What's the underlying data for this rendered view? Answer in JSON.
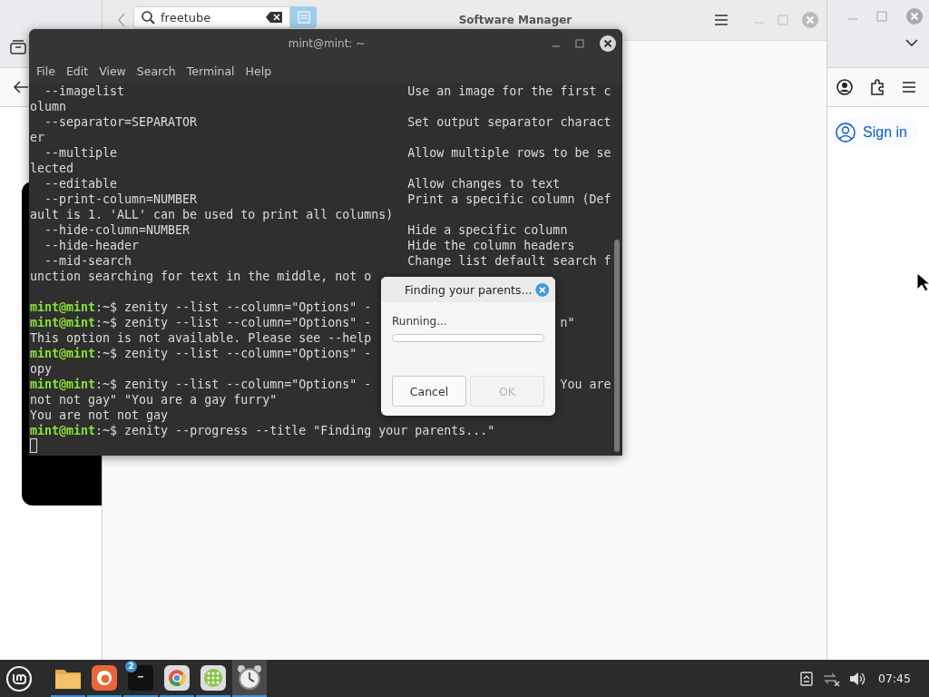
{
  "browser": {
    "sign_in": "Sign in"
  },
  "software_manager": {
    "title": "Software Manager",
    "search": {
      "value": "freetube"
    }
  },
  "terminal": {
    "title": "mint@mint: ~",
    "menu": [
      "File",
      "Edit",
      "View",
      "Search",
      "Terminal",
      "Help"
    ],
    "lines": [
      {
        "kind": "option",
        "option": "--imagelist",
        "description": "Use an image for the first c"
      },
      {
        "kind": "text",
        "text": "olumn"
      },
      {
        "kind": "option",
        "option": "--separator=SEPARATOR",
        "description": "Set output separator charact"
      },
      {
        "kind": "text",
        "text": "er"
      },
      {
        "kind": "option",
        "option": "--multiple",
        "description": "Allow multiple rows to be se"
      },
      {
        "kind": "text",
        "text": "lected"
      },
      {
        "kind": "option",
        "option": "--editable",
        "description": "Allow changes to text"
      },
      {
        "kind": "option",
        "option": "--print-column=NUMBER",
        "description": "Print a specific column (Def"
      },
      {
        "kind": "text",
        "text": "ault is 1. 'ALL' can be used to print all columns)"
      },
      {
        "kind": "option",
        "option": "--hide-column=NUMBER",
        "description": "Hide a specific column"
      },
      {
        "kind": "option",
        "option": "--hide-header",
        "description": "Hide the column headers"
      },
      {
        "kind": "option",
        "option": "--mid-search",
        "description": "Change list default search f"
      },
      {
        "kind": "text",
        "text": "unction searching for text in the middle, not o"
      },
      {
        "kind": "blank"
      },
      {
        "kind": "prompt",
        "user": "mint@mint",
        "dir": ":~$",
        "command": "zenity --list --column=\"Options\" -"
      },
      {
        "kind": "prompt",
        "user": "mint@mint",
        "dir": ":~$",
        "command": "zenity --list --column=\"Options\" -",
        "tail": "n\""
      },
      {
        "kind": "text",
        "text": "This option is not available. Please see --help"
      },
      {
        "kind": "prompt",
        "user": "mint@mint",
        "dir": ":~$",
        "command": "zenity --list --column=\"Options\" -"
      },
      {
        "kind": "text",
        "text": "opy"
      },
      {
        "kind": "prompt",
        "user": "mint@mint",
        "dir": ":~$",
        "command": "zenity --list --column=\"Options\" -",
        "tail": "You are"
      },
      {
        "kind": "text",
        "text": "not not gay\" \"You are a gay furry\""
      },
      {
        "kind": "text",
        "text": "You are not not gay"
      },
      {
        "kind": "prompt",
        "user": "mint@mint",
        "dir": ":~$",
        "command": "zenity --progress --title \"Finding your parents...\""
      },
      {
        "kind": "cursor"
      }
    ]
  },
  "dialog": {
    "title": "Finding your parents...",
    "status": "Running...",
    "progress": {
      "level": 0
    },
    "buttons": [
      {
        "label": "Cancel",
        "disabled": false
      },
      {
        "label": "OK",
        "disabled": true
      }
    ]
  },
  "taskbar": {
    "apps": [
      {
        "kind": "files",
        "selected": false
      },
      {
        "kind": "browser",
        "selected": false
      },
      {
        "kind": "terminal",
        "selected": false,
        "badge": "2"
      },
      {
        "kind": "chrome",
        "selected": false
      },
      {
        "kind": "grid",
        "selected": false
      },
      {
        "kind": "clock",
        "selected": true
      }
    ],
    "clock": "07:45"
  }
}
